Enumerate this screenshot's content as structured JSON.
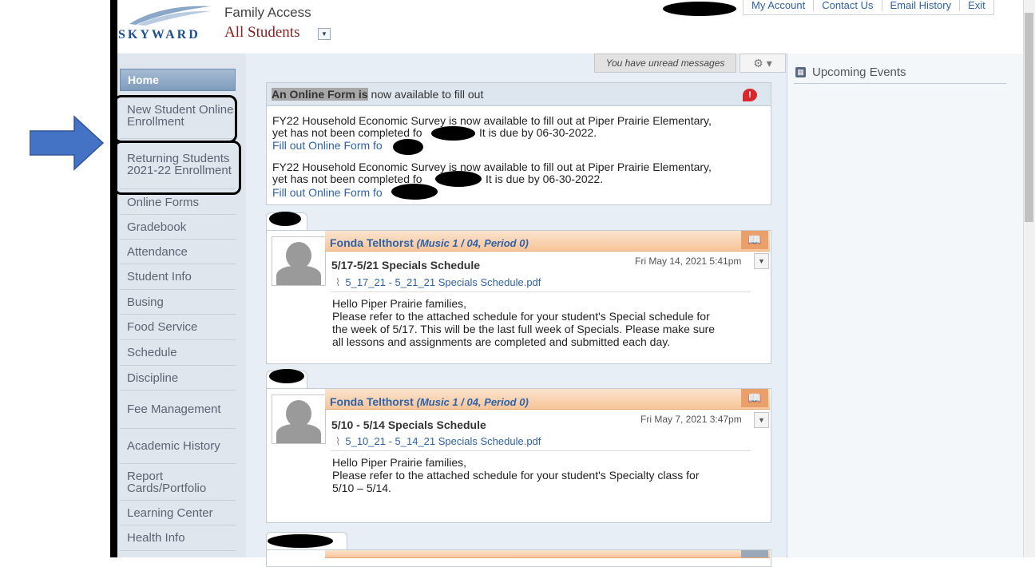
{
  "header": {
    "logo_text": "SKYWARD",
    "app_title": "Family Access",
    "student_selector": "All Students",
    "top_links": [
      "My Account",
      "Contact Us",
      "Email History",
      "Exit"
    ]
  },
  "sidebar": {
    "items": [
      {
        "label": "Home"
      },
      {
        "label": "New Student Online Enrollment"
      },
      {
        "label": "Returning Students 2021-22 Enrollment"
      },
      {
        "label": "Online Forms"
      },
      {
        "label": "Gradebook"
      },
      {
        "label": "Attendance"
      },
      {
        "label": "Student Info"
      },
      {
        "label": "Busing"
      },
      {
        "label": "Food Service"
      },
      {
        "label": "Schedule"
      },
      {
        "label": "Discipline"
      },
      {
        "label": "Fee Management"
      },
      {
        "label": "Academic History"
      },
      {
        "label": "Report Cards/Portfolio"
      },
      {
        "label": "Learning Center"
      },
      {
        "label": "Health Info"
      }
    ]
  },
  "toolbar": {
    "messages": "You have unread messages"
  },
  "online_form": {
    "title_highlight": "An Online Form is",
    "title_rest": " now available to fill out",
    "entries": [
      {
        "line1": "FY22 Household Economic Survey is now available to fill out at Piper Prairie Elementary,",
        "line2_start": "yet has not been completed fo",
        "line2_end": "It is due by 06-30-2022.",
        "link": "Fill out Online Form fo"
      },
      {
        "line1": "FY22 Household Economic Survey is now available to fill out at Piper Prairie Elementary,",
        "line2_start": "yet has not been completed fo",
        "line2_end": "It is due by 06-30-2022.",
        "link": "Fill out Online Form fo"
      }
    ]
  },
  "posts": [
    {
      "teacher": "Fonda Telthorst",
      "class": "(Music 1 / 04, Period 0)",
      "title": "5/17-5/21 Specials Schedule",
      "date": "Fri May 14, 2021 5:41pm",
      "attachment": "5_17_21 - 5_21_21 Specials Schedule.pdf",
      "body": [
        "Hello Piper Prairie families,",
        "Please refer to the attached schedule for your student's Special schedule for",
        "the week of 5/17. This will be the last full week of Specials. Please make sure",
        "all lessons and assignments are completed and submitted each day."
      ]
    },
    {
      "teacher": "Fonda Telthorst",
      "class": "(Music 1 / 04, Period 0)",
      "title": "5/10 - 5/14 Specials Schedule",
      "date": "Fri May 7, 2021 3:47pm",
      "attachment": "5_10_21 - 5_14_21 Specials Schedule.pdf",
      "body": [
        "Hello Piper Prairie families,",
        "Please refer to the attached schedule for your student's Specialty class for",
        "5/10 – 5/14."
      ]
    }
  ],
  "right_panel": {
    "title": "Upcoming Events"
  },
  "colors": {
    "link": "#2f63a8",
    "sidebar_bg": "#dfe6ee",
    "post_header": "#f7c59a",
    "alert": "#d9282d",
    "arrow": "#4472c4"
  }
}
